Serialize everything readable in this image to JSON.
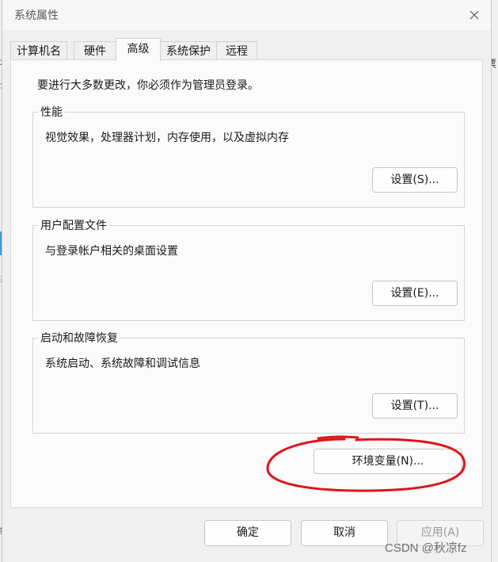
{
  "window": {
    "title": "系统属性"
  },
  "tabs": [
    "计算机名",
    "硬件",
    "高级",
    "系统保护",
    "远程"
  ],
  "active_tab": "高级",
  "notice": "要进行大多数更改，你必须作为管理员登录。",
  "groups": [
    {
      "legend": "性能",
      "description": "视觉效果，处理器计划，内存使用，以及虚拟内存",
      "button": "设置(S)..."
    },
    {
      "legend": "用户配置文件",
      "description": "与登录帐户相关的桌面设置",
      "button": "设置(E)..."
    },
    {
      "legend": "启动和故障恢复",
      "description": "系统启动、系统故障和调试信息",
      "button": "设置(T)..."
    }
  ],
  "env_button": "环境变量(N)...",
  "footer": {
    "ok": "确定",
    "cancel": "取消",
    "apply": "应用(A)"
  },
  "watermark": "CSDN @秋凉fz",
  "background_fragments": {
    "left": [
      "块",
      "云",
      "系",
      "统"
    ],
    "right": [
      "票"
    ]
  },
  "colors": {
    "annotation_circle": "#e0141b",
    "accent_blue": "#3c9ad8"
  }
}
